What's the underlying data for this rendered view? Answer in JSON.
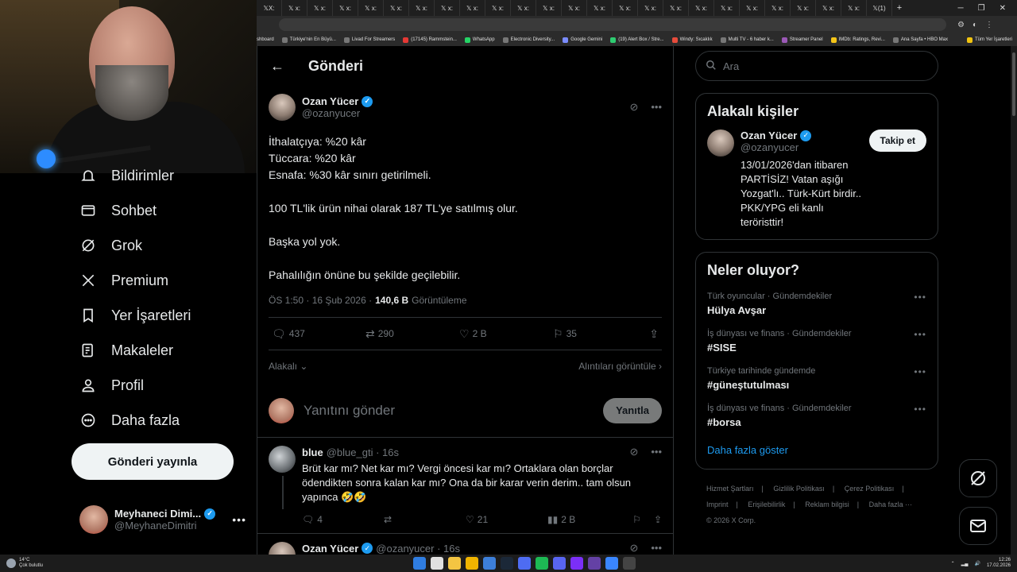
{
  "browser": {
    "tab_label": "X",
    "tab_count_label": "(1)",
    "bookmarks": [
      "shboard",
      "Türkiye'nin En Büyü...",
      "Livad For Streamers",
      "(17145) Rammstein...",
      "WhatsApp",
      "Electronic Diversity...",
      "Google Gemini",
      "(19) Alert Box / Stre...",
      "Windy: Sıcaklık",
      "Multi TV - 6 haber k...",
      "Streamer Panel",
      "IMDb: Ratings, Revi...",
      "Ana Sayfa • HBO Max"
    ],
    "bookmarks_other": "Tüm Yer İşaretleri"
  },
  "nav": {
    "items": [
      {
        "label": "Bildirimler",
        "icon": "bell-icon"
      },
      {
        "label": "Sohbet",
        "icon": "mail-icon"
      },
      {
        "label": "Grok",
        "icon": "grok-icon"
      },
      {
        "label": "Premium",
        "icon": "x-logo-icon"
      },
      {
        "label": "Yer İşaretleri",
        "icon": "bookmark-icon"
      },
      {
        "label": "Makaleler",
        "icon": "article-icon"
      },
      {
        "label": "Profil",
        "icon": "person-icon"
      },
      {
        "label": "Daha fazla",
        "icon": "more-circle-icon"
      }
    ],
    "post_button": "Gönderi yayınla",
    "account": {
      "name": "Meyhaneci Dimi...",
      "handle": "@MeyhaneDimitri"
    }
  },
  "main": {
    "title": "Gönderi",
    "post": {
      "author": "Ozan Yücer",
      "handle": "@ozanyucer",
      "lines": [
        "İthalatçıya: %20 kâr",
        "Tüccara: %20 kâr",
        "Esnafa: %30 kâr sınırı getirilmeli.",
        "",
        "100 TL'lik ürün nihai olarak 187 TL'ye satılmış olur.",
        "",
        "Başka yol yok.",
        "",
        "Pahalılığın önüne bu şekilde geçilebilir."
      ],
      "time": "ÖS 1:50 · 16 Şub 2026 ·",
      "views": "140,6 B",
      "views_label": "Görüntüleme",
      "replies": "437",
      "reposts": "290",
      "likes": "2 B",
      "bookmarks": "35"
    },
    "sort_label": "Alakalı",
    "quotes_label": "Alıntıları görüntüle",
    "reply_placeholder": "Yanıtını gönder",
    "reply_button": "Yanıtla",
    "replies": [
      {
        "name": "blue",
        "handle": "@blue_gti · 16s",
        "text": "Brüt kar mı? Net kar mı? Vergi öncesi kar mı? Ortaklara olan borçlar ödendikten sonra kalan kar mı? Ona da bir karar verin derim.. tam olsun yapınca 🤣🤣",
        "replies": "4",
        "reposts": "",
        "likes": "21",
        "views": "2 B"
      },
      {
        "name": "Ozan Yücer",
        "handle": "@ozanyucer · 16s"
      }
    ]
  },
  "right": {
    "search_placeholder": "Ara",
    "related_title": "Alakalı kişiler",
    "related_user": {
      "name": "Ozan Yücer",
      "handle": "@ozanyucer",
      "bio": "13/01/2026'dan itibaren PARTİSİZ! Vatan aşığı Yozgat'lı.. Türk-Kürt birdir.. PKK/YPG eli kanlı teröristtir!",
      "follow": "Takip et"
    },
    "trends_title": "Neler oluyor?",
    "trends": [
      {
        "category": "Türk oyuncular · Gündemdekiler",
        "name": "Hülya Avşar"
      },
      {
        "category": "İş dünyası ve finans · Gündemdekiler",
        "name": "#SISE"
      },
      {
        "category": "Türkiye tarihinde gündemde",
        "name": "#güneştutulması"
      },
      {
        "category": "İş dünyası ve finans · Gündemdekiler",
        "name": "#borsa"
      }
    ],
    "show_more": "Daha fazla göster",
    "footer_row1": [
      "Hizmet Şartları",
      "|",
      "Gizlilik Politikası",
      "|",
      "Çerez Politikası",
      "|"
    ],
    "footer_row2": [
      "Imprint",
      "|",
      "Erişilebilirlik",
      "|",
      "Reklam bilgisi",
      "|",
      "Daha fazla ···"
    ],
    "copyright": "© 2026 X Corp."
  },
  "taskbar": {
    "temp": "14°C",
    "weather": "Çok bulutlu",
    "time": "12:26",
    "date": "17.02.2026"
  },
  "colors": {
    "accent": "#1d9bf0",
    "background": "#000000",
    "border": "#2f3336",
    "muted": "#71767b"
  }
}
